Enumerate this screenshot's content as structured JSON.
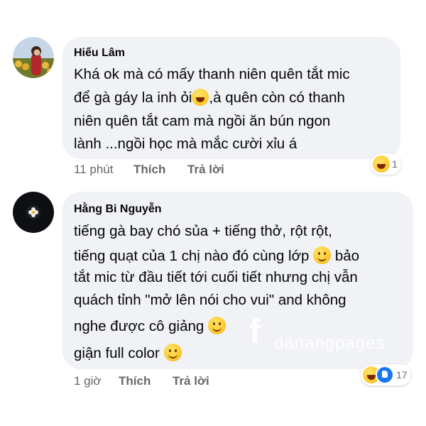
{
  "comments": [
    {
      "author": "Hiếu Lâm",
      "lines": [
        "Khá ok mà có mấy thanh niên quên tắt mic",
        "để gà gáy la inh ỏi",
        ",à quên còn có thanh",
        "niên quên tắt cam mà ngồi ăn bún ngon",
        "lành ...ngồi học mà mắc cười xỉu á"
      ],
      "time": "11 phút",
      "like_label": "Thích",
      "reply_label": "Trả lời",
      "reaction_count": "1"
    },
    {
      "author": "Hằng Bi Nguyễn",
      "lines": [
        "tiếng gà bay chó sủa + tiếng thở, rột rột,",
        "tiếng quạt của 1 chị nào đó cùng lớp",
        "bảo",
        "tắt mic từ đầu tiết tới cuối tiết nhưng chị vẫn",
        "quách tỉnh \"mở lên nói cho vui\" and không",
        "nghe được cô giảng",
        "giận full color"
      ],
      "time": "1 giờ",
      "like_label": "Thích",
      "reply_label": "Trả lời",
      "reaction_count": "17"
    }
  ],
  "watermark": "danangpages",
  "colors": {
    "bubble": "#f0f2f5",
    "meta_text": "#65676b",
    "like_blue": "#1877f2"
  },
  "icons": [
    "avatar-photo",
    "laughing-tears-emoji",
    "smile-emoji",
    "haha-reaction-icon",
    "like-reaction-icon"
  ]
}
